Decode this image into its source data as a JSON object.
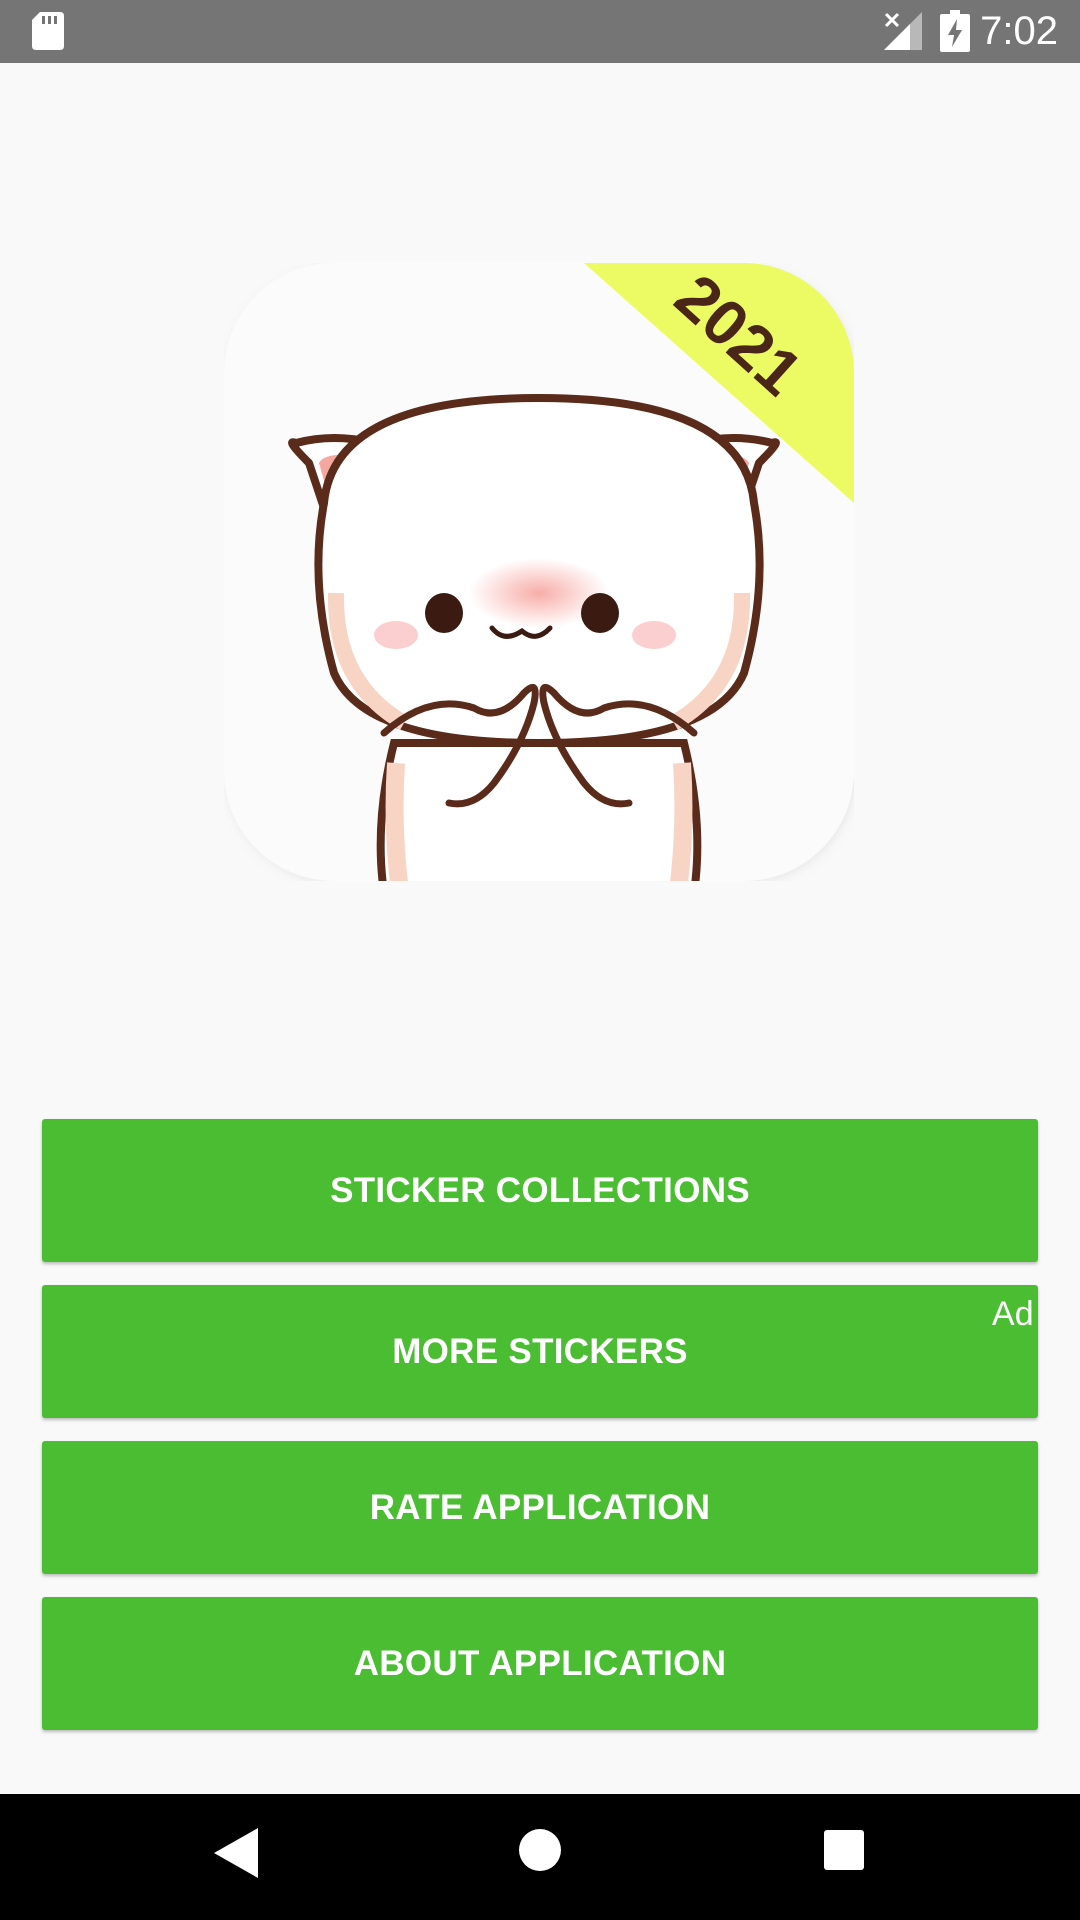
{
  "status_bar": {
    "time": "7:02",
    "icons": [
      "sd-card-icon",
      "signal-no-service-icon",
      "battery-charging-icon"
    ]
  },
  "logo": {
    "badge_text": "2021",
    "icon": "cute-cat-sticker-icon"
  },
  "buttons": {
    "sticker_collections": "STICKER COLLECTIONS",
    "more_stickers": "MORE STICKERS",
    "ad_label": "Ad",
    "rate_application": "RATE APPLICATION",
    "about_application": "ABOUT APPLICATION"
  },
  "nav_bar": {
    "icons": [
      "back-icon",
      "home-icon",
      "recents-icon"
    ]
  },
  "colors": {
    "accent": "#4bbd33",
    "status_bar": "#757575",
    "nav_bar": "#000000",
    "background": "#f9f9f9",
    "badge": "#ecfa63",
    "badge_text": "#4a2619"
  }
}
